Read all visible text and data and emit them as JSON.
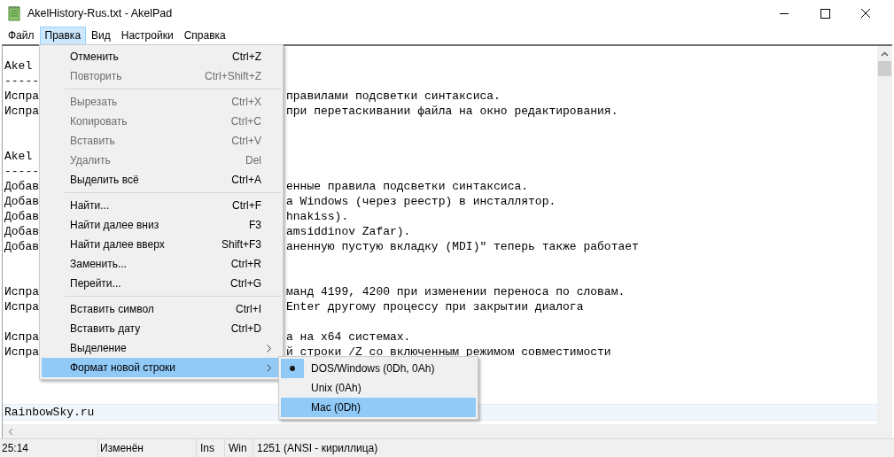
{
  "window": {
    "title": "AkelHistory-Rus.txt - AkelPad"
  },
  "menu_bar": [
    {
      "label": "Файл",
      "selected": false
    },
    {
      "label": "Правка",
      "selected": true
    },
    {
      "label": "Вид",
      "selected": false
    },
    {
      "label": "Настройки",
      "selected": false
    },
    {
      "label": "Справка",
      "selected": false
    }
  ],
  "editor": {
    "sections": [
      {
        "blocks": [
          {
            "lines": [
              {
                "left": "Akel"
              },
              {
                "left": "-----"
              },
              {
                "left": "Испра",
                "right": "правилами подсветки синтаксиса."
              },
              {
                "left": "Испра",
                "right": "при перетаскивании файла на окно редактирования."
              }
            ]
          }
        ]
      },
      {
        "blocks": [
          {
            "lines": [
              {
                "left": "Akel"
              },
              {
                "left": "-----"
              },
              {
                "left": "Добав",
                "right": "енные правила подсветки синтаксиса."
              },
              {
                "left": "Добав",
                "right": "а Windows (через реестр) в инсталлятор."
              },
              {
                "left": "Добав",
                "right": "hnakiss)."
              },
              {
                "left": "Добав",
                "right": "amsiddinov Zafar)."
              },
              {
                "left": "Добав",
                "right": "аненную пустую вкладку (MDI)\" теперь также работает"
              }
            ]
          }
        ]
      },
      {
        "blocks": [
          {
            "lines": [
              {
                "left": "Испра",
                "right": "манд 4199, 4200 при изменении переноса по словам."
              },
              {
                "left": "Испра",
                "right": "Enter другому процессу при закрытии диалога"
              }
            ]
          },
          {
            "lines": [
              {
                "left": "Испра",
                "right": "а на x64 системах."
              },
              {
                "left": "Испра",
                "right": "й строки /Z со включенным режимом совместимости"
              }
            ]
          }
        ]
      },
      {
        "blocks": [
          {
            "lines": [
              {
                "left": "RainbowSky.ru",
                "current": true
              }
            ]
          }
        ]
      }
    ]
  },
  "edit_menu": [
    {
      "kind": "item",
      "label": "Отменить",
      "shortcut": "Ctrl+Z",
      "disabled": false,
      "selected": false,
      "submenu": false
    },
    {
      "kind": "item",
      "label": "Повторить",
      "shortcut": "Ctrl+Shift+Z",
      "disabled": true,
      "selected": false,
      "submenu": false
    },
    {
      "kind": "separator"
    },
    {
      "kind": "item",
      "label": "Вырезать",
      "shortcut": "Ctrl+X",
      "disabled": true,
      "selected": false,
      "submenu": false
    },
    {
      "kind": "item",
      "label": "Копировать",
      "shortcut": "Ctrl+C",
      "disabled": true,
      "selected": false,
      "submenu": false
    },
    {
      "kind": "item",
      "label": "Вставить",
      "shortcut": "Ctrl+V",
      "disabled": true,
      "selected": false,
      "submenu": false
    },
    {
      "kind": "item",
      "label": "Удалить",
      "shortcut": "Del",
      "disabled": true,
      "selected": false,
      "submenu": false
    },
    {
      "kind": "item",
      "label": "Выделить всё",
      "shortcut": "Ctrl+A",
      "disabled": false,
      "selected": false,
      "submenu": false
    },
    {
      "kind": "separator"
    },
    {
      "kind": "item",
      "label": "Найти...",
      "shortcut": "Ctrl+F",
      "disabled": false,
      "selected": false,
      "submenu": false
    },
    {
      "kind": "item",
      "label": "Найти далее вниз",
      "shortcut": "F3",
      "disabled": false,
      "selected": false,
      "submenu": false
    },
    {
      "kind": "item",
      "label": "Найти далее вверх",
      "shortcut": "Shift+F3",
      "disabled": false,
      "selected": false,
      "submenu": false
    },
    {
      "kind": "item",
      "label": "Заменить...",
      "shortcut": "Ctrl+R",
      "disabled": false,
      "selected": false,
      "submenu": false
    },
    {
      "kind": "item",
      "label": "Перейти...",
      "shortcut": "Ctrl+G",
      "disabled": false,
      "selected": false,
      "submenu": false
    },
    {
      "kind": "separator"
    },
    {
      "kind": "item",
      "label": "Вставить символ",
      "shortcut": "Ctrl+I",
      "disabled": false,
      "selected": false,
      "submenu": false
    },
    {
      "kind": "item",
      "label": "Вставить дату",
      "shortcut": "Ctrl+D",
      "disabled": false,
      "selected": false,
      "submenu": false
    },
    {
      "kind": "item",
      "label": "Выделение",
      "disabled": false,
      "selected": false,
      "submenu": true
    },
    {
      "kind": "item",
      "label": "Формат новой строки",
      "disabled": false,
      "selected": true,
      "submenu": true
    }
  ],
  "newline_submenu": [
    {
      "label": "DOS/Windows (0Dh, 0Ah)",
      "checked": true,
      "selected": false
    },
    {
      "label": "Unix (0Ah)",
      "checked": false,
      "selected": false
    },
    {
      "label": "Mac (0Dh)",
      "checked": false,
      "selected": true
    }
  ],
  "status_bar": {
    "position": "25:14",
    "modified": "Изменён",
    "insert_mode": "Ins",
    "newline": "Win",
    "codepage": "1251  (ANSI - кириллица)"
  }
}
